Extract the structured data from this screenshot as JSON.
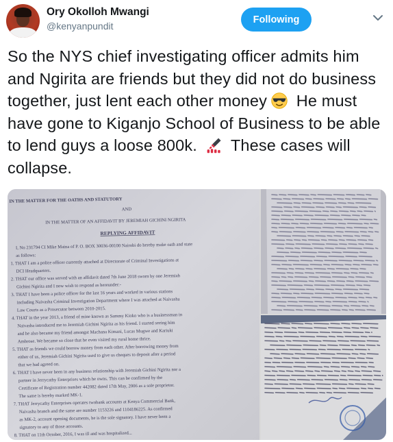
{
  "user": {
    "display_name": "Ory Okolloh Mwangi",
    "handle": "@kenyanpundit"
  },
  "follow_button": {
    "label": "Following"
  },
  "tweet": {
    "part1": "So the NYS chief investigating officer admits him and Ngirita are friends but they did not do business together, just lent each other money",
    "emoji1": "smiling-face-with-sunglasses",
    "part2": " He must have gone to Kiganjo School of Business to be able to lend guys a loose 800k.",
    "emoji2": "nail-polish",
    "part3": " These cases will collapse."
  },
  "photos": {
    "main": {
      "top_line": "IN THE MATTER FOR THE OATHS AND STATUTORY",
      "and": "AND",
      "matter_line": "IN THE MATTER OF AN AFFIDAVIT BY JEREMIAH GICHINI NGIRITA",
      "doc_title": "REPLYING AFFIDAVIT",
      "lines": [
        "I, No 231794 CI Mike Maina of P. O. BOX 30036-00100 Nairobi do hereby make oath and state",
        "as follows:",
        "1. THAT I am a police officer currently attached at Directorate of Criminal Investigations at",
        "DCI Headquarters.",
        "2. THAT our office was served with an affidavit dated 7th June 2018 sworn by one Jeremiah",
        "Gichini Ngirita and I now wish to respond as hereunder:-",
        "3. THAT I have been a police officer for the last 16 years and worked in various stations",
        "including Naivasha Criminal Investigation Department where I was attached at Naivasha",
        "Law Courts as a Prosecutor between 2010-2015.",
        "4. THAT in the year 2013, a friend of mine known as Sammy Kioko who is a businessman in",
        "Naivasha introduced me to Jeremiah Gichini Ngirita as his friend. I started seeing him",
        "and he also became my friend amongst Machana Kimani, Lucas Mugwe and Kariuki",
        "Ambrose. We became so close that he even visited my rural home thrice.",
        "5. THAT as friends we could borrow money from each other. After borrowing money from",
        "either of us, Jeremiah Gichini Ngirita used to give us cheques to deposit after a period",
        "that we had agreed on.",
        "6. THAT I have never been in any business relationship with Jeremiah Gichini Ngirita nor a",
        "partner in Jerrycathy Enterprises which he owns. This can be confirmed by the",
        "Certificate of Registration number 442082 dated 17th May, 2006 as a sole proprietor.",
        "The same is hereby marked MK-1.",
        "7. THAT Jerrycathy Enterprises operates twobank accounts at Kenya Commercial Bank,",
        "Naivasha branch and the same are number 1153226 and 1104186225. As confirmed",
        "as MK-2, account opening documents, he is the sole signatory. I have never been a",
        "signatory to any of those accounts.",
        "8. THAT on 11th October, 2016, I was ill and was hospitalized..."
      ]
    }
  }
}
